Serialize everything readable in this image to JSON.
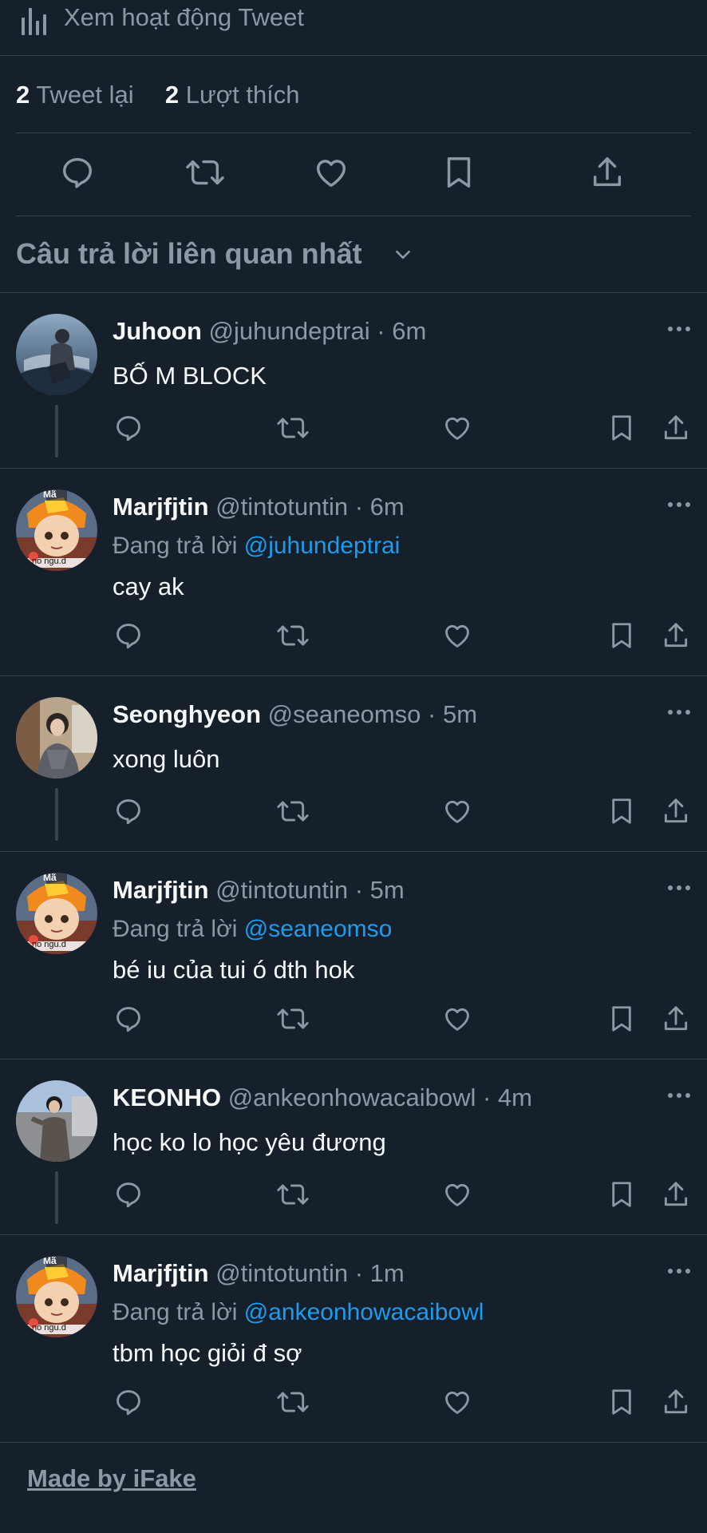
{
  "activity": {
    "label": "Xem hoạt động Tweet",
    "icon": "analytics-icon"
  },
  "stats": {
    "retweets_count": "2",
    "retweets_label": "Tweet lại",
    "likes_count": "2",
    "likes_label": "Lượt thích"
  },
  "actions": [
    "reply-icon",
    "retweet-icon",
    "like-icon",
    "bookmark-icon",
    "share-icon"
  ],
  "sort": {
    "label": "Câu trả lời liên quan nhất"
  },
  "replies": [
    {
      "name": "Juhoon",
      "handle": "@juhundeptrai",
      "time": "· 6m",
      "replying_to": null,
      "text": "BỐ M BLOCK"
    },
    {
      "name": "Marjfjtin",
      "handle": "@tintotuntin",
      "time": "· 6m",
      "replying_label": "Đang trả lời",
      "replying_to": "@juhundeptrai",
      "text": "cay ak"
    },
    {
      "name": "Seonghyeon",
      "handle": "@seaneomso",
      "time": "· 5m",
      "replying_to": null,
      "text": "xong luôn"
    },
    {
      "name": "Marjfjtin",
      "handle": "@tintotuntin",
      "time": "· 5m",
      "replying_label": "Đang trả lời",
      "replying_to": "@seaneomso",
      "text": "bé iu của tui ó dth hok"
    },
    {
      "name": "KEONHO",
      "handle": "@ankeonhowacaibowl",
      "time": "· 4m",
      "replying_to": null,
      "text": "học ko lo học yêu đương"
    },
    {
      "name": "Marjfjtin",
      "handle": "@tintotuntin",
      "time": "· 1m",
      "replying_label": "Đang trả lời",
      "replying_to": "@ankeonhowacaibowl",
      "text": "tbm học giỏi đ sợ"
    }
  ],
  "avatar_badge": {
    "top": "Mã",
    "bottom": "no ngu.d"
  },
  "footer": {
    "label": "Made by iFake"
  },
  "colors": {
    "background": "#15202b",
    "text": "#f7f9f9",
    "muted": "#8b98a5",
    "accent": "#1d9bf0",
    "border": "#38444d"
  }
}
